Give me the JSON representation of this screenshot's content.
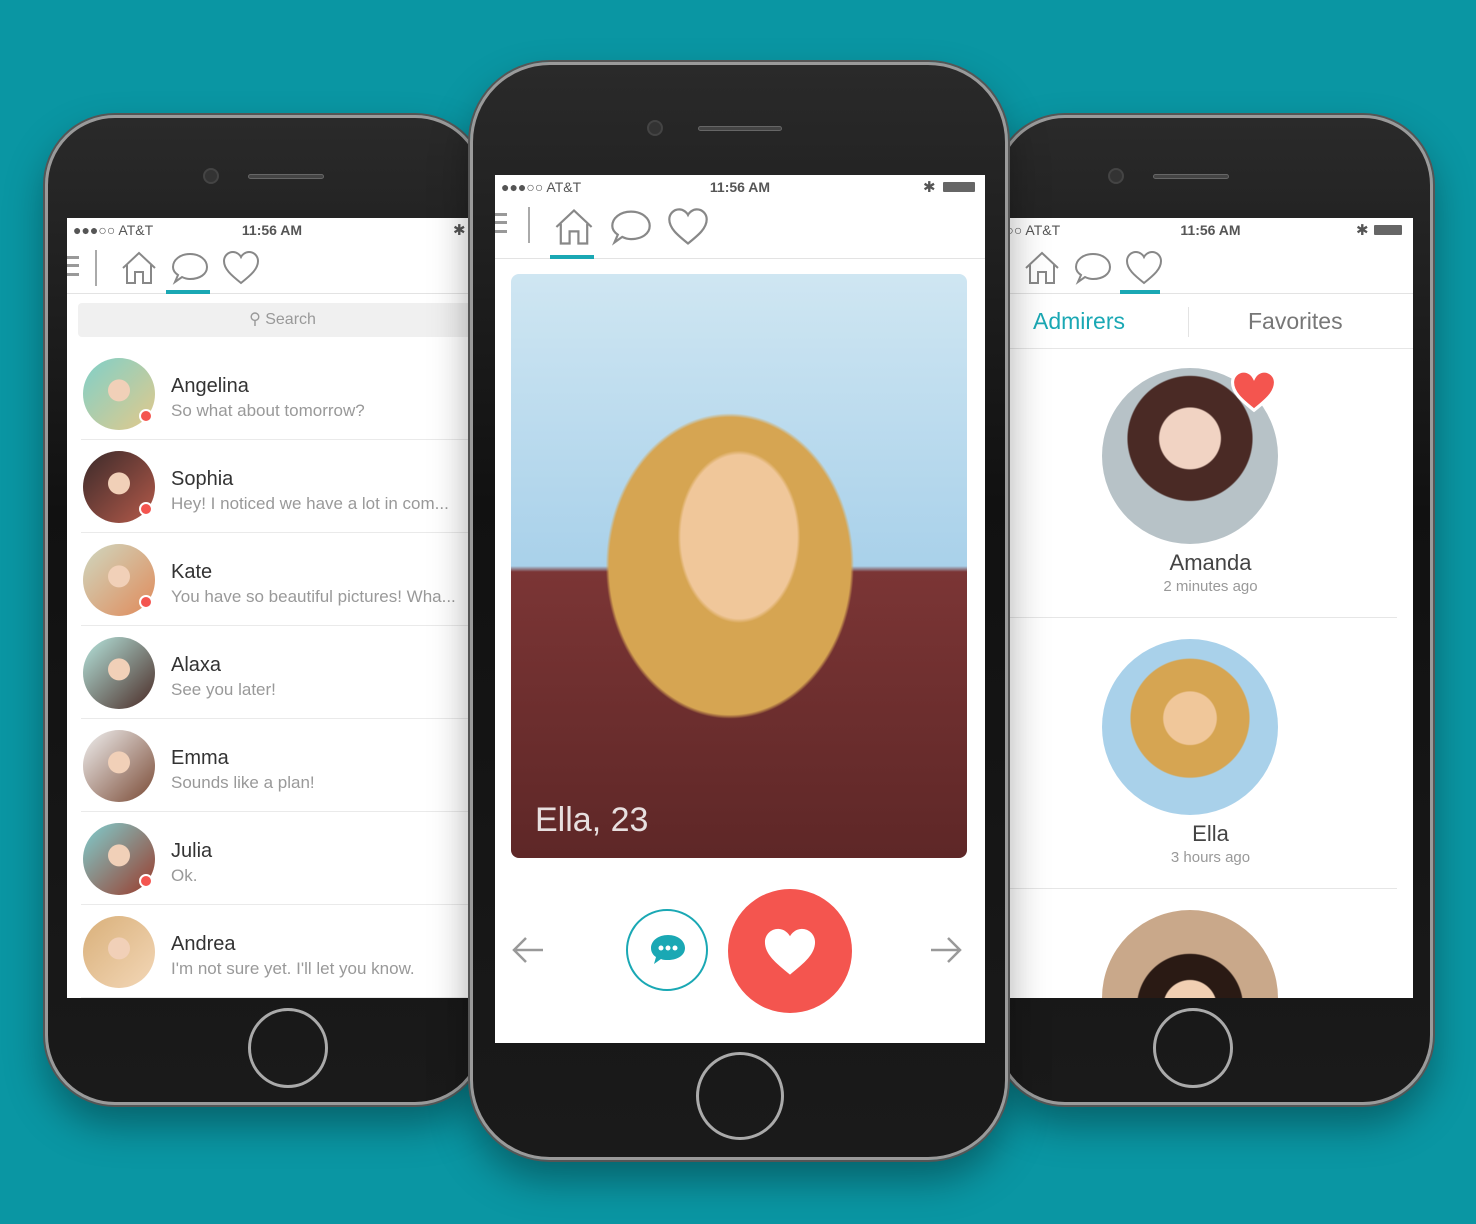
{
  "status": {
    "carrier": "●●●○○ AT&T",
    "time": "11:56 AM",
    "bluetooth": "✱"
  },
  "nav_icons": [
    "home-icon",
    "chat-bubble-icon",
    "heart-icon"
  ],
  "colors": {
    "background": "#0a96a3",
    "accent": "#1aa8b4",
    "like": "#f4554f"
  },
  "messages": {
    "search_placeholder": "Search",
    "items": [
      {
        "name": "Angelina",
        "message": "So what about tomorrow?",
        "unread": true
      },
      {
        "name": "Sophia",
        "message": "Hey! I noticed we have a lot in com...",
        "unread": true
      },
      {
        "name": "Kate",
        "message": "You have so beautiful pictures! Wha...",
        "unread": true
      },
      {
        "name": "Alaxa",
        "message": "See you later!",
        "unread": false
      },
      {
        "name": "Emma",
        "message": "Sounds like a plan!",
        "unread": false
      },
      {
        "name": "Julia",
        "message": "Ok.",
        "unread": true
      },
      {
        "name": "Andrea",
        "message": "I'm not sure yet. I'll let you know.",
        "unread": false
      }
    ]
  },
  "discover": {
    "card_label": "Ella, 23"
  },
  "admirers": {
    "tabs": {
      "active": "Admirers",
      "other": "Favorites"
    },
    "items": [
      {
        "name": "Amanda",
        "time": "2 minutes ago"
      },
      {
        "name": "Ella",
        "time": "3 hours ago"
      }
    ]
  }
}
